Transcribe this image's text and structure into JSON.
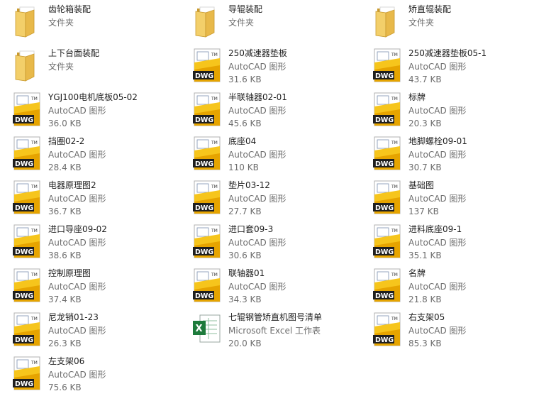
{
  "colors": {
    "text": "#1e1e1e",
    "secondary": "#6d6d6d",
    "folder": "#e8c25a",
    "dwg_badge": "#1f1f1f",
    "dwg_yellow": "#f6c51c",
    "excel": "#1d7b3b"
  },
  "files": [
    {
      "name": "齿轮箱装配",
      "type": "文件夹",
      "size": "",
      "icon": "folder-icon"
    },
    {
      "name": "导辊装配",
      "type": "文件夹",
      "size": "",
      "icon": "folder-icon"
    },
    {
      "name": "矫直辊装配",
      "type": "文件夹",
      "size": "",
      "icon": "folder-icon"
    },
    {
      "name": "上下台面装配",
      "type": "文件夹",
      "size": "",
      "icon": "folder-icon"
    },
    {
      "name": "250减速器垫板",
      "type": "AutoCAD 图形",
      "size": "31.6 KB",
      "icon": "dwg-icon"
    },
    {
      "name": "250减速器垫板05-1",
      "type": "AutoCAD 图形",
      "size": "43.7 KB",
      "icon": "dwg-icon"
    },
    {
      "name": "YGJ100电机底板05-02",
      "type": "AutoCAD 图形",
      "size": "36.0 KB",
      "icon": "dwg-icon"
    },
    {
      "name": "半联轴器02-01",
      "type": "AutoCAD 图形",
      "size": "45.6 KB",
      "icon": "dwg-icon"
    },
    {
      "name": "标牌",
      "type": "AutoCAD 图形",
      "size": "20.3 KB",
      "icon": "dwg-icon"
    },
    {
      "name": "挡圈02-2",
      "type": "AutoCAD 图形",
      "size": "28.4 KB",
      "icon": "dwg-icon"
    },
    {
      "name": "底座04",
      "type": "AutoCAD 图形",
      "size": "110 KB",
      "icon": "dwg-icon"
    },
    {
      "name": "地脚螺栓09-01",
      "type": "AutoCAD 图形",
      "size": "30.7 KB",
      "icon": "dwg-icon"
    },
    {
      "name": "电器原理图2",
      "type": "AutoCAD 图形",
      "size": "36.7 KB",
      "icon": "dwg-icon"
    },
    {
      "name": "垫片03-12",
      "type": "AutoCAD 图形",
      "size": "27.7 KB",
      "icon": "dwg-icon"
    },
    {
      "name": "基础图",
      "type": "AutoCAD 图形",
      "size": "137 KB",
      "icon": "dwg-icon"
    },
    {
      "name": "进口导座09-02",
      "type": "AutoCAD 图形",
      "size": "38.6 KB",
      "icon": "dwg-icon"
    },
    {
      "name": "进口套09-3",
      "type": "AutoCAD 图形",
      "size": "30.6 KB",
      "icon": "dwg-icon"
    },
    {
      "name": "进料底座09-1",
      "type": "AutoCAD 图形",
      "size": "35.1 KB",
      "icon": "dwg-icon"
    },
    {
      "name": "控制原理图",
      "type": "AutoCAD 图形",
      "size": "37.4 KB",
      "icon": "dwg-icon"
    },
    {
      "name": "联轴器01",
      "type": "AutoCAD 图形",
      "size": "34.3 KB",
      "icon": "dwg-icon"
    },
    {
      "name": "名牌",
      "type": "AutoCAD 图形",
      "size": "21.8 KB",
      "icon": "dwg-icon"
    },
    {
      "name": "尼龙销01-23",
      "type": "AutoCAD 图形",
      "size": "26.3 KB",
      "icon": "dwg-icon"
    },
    {
      "name": "七辊钢管矫直机图号清单",
      "type": "Microsoft Excel 工作表",
      "size": "20.0 KB",
      "icon": "excel-icon"
    },
    {
      "name": "右支架05",
      "type": "AutoCAD 图形",
      "size": "85.3 KB",
      "icon": "dwg-icon"
    },
    {
      "name": "左支架06",
      "type": "AutoCAD 图形",
      "size": "75.6 KB",
      "icon": "dwg-icon"
    }
  ]
}
